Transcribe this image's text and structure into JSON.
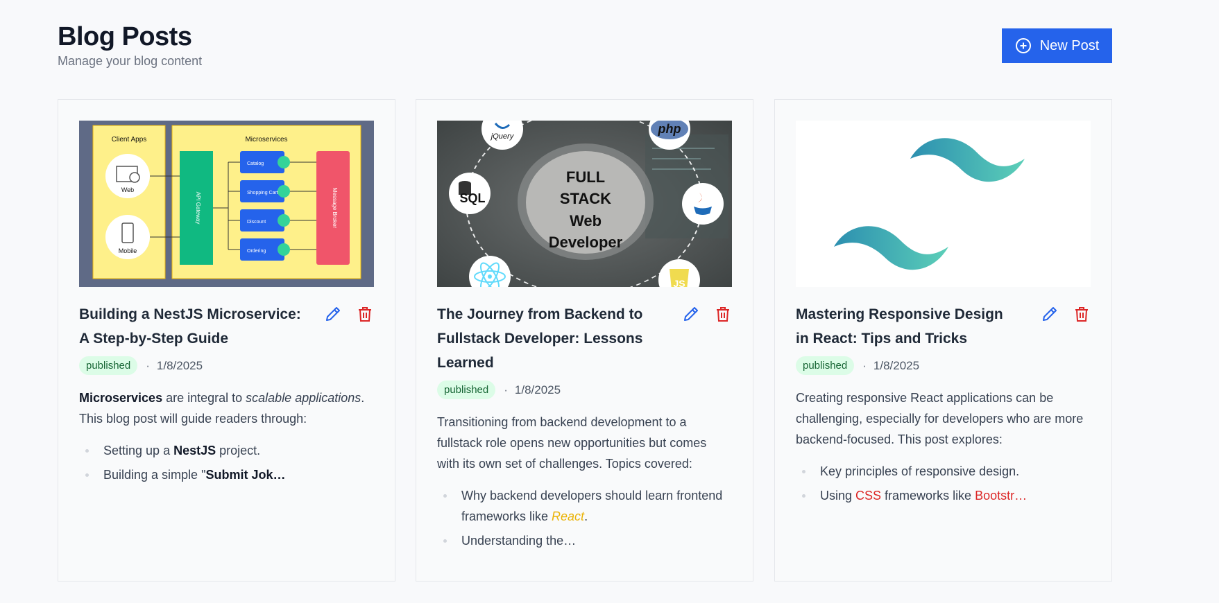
{
  "page": {
    "title": "Blog Posts",
    "subtitle": "Manage your blog content",
    "new_post_label": "New Post"
  },
  "colors": {
    "primary": "#2563eb",
    "delete": "#dc2626",
    "badge_bg": "#dcfce7",
    "badge_text": "#166534"
  },
  "posts": [
    {
      "title": "Building a NestJS Microservice: A Step-by-Step Guide",
      "status": "published",
      "date": "1/8/2025",
      "image": {
        "client_apps": "Client Apps",
        "microservices": "Microservices",
        "web": "Web",
        "mobile": "Mobile",
        "api_gateway": "API Gateway",
        "services": [
          "Catalog",
          "Shopping Cart",
          "Discount",
          "Ordering"
        ],
        "broker": "Message Broker"
      },
      "excerpt": {
        "strong": "Microservices",
        "t1": " are integral to ",
        "em": "scalable applications",
        "t2": ". This blog post will guide readers through:"
      },
      "bullets": [
        {
          "pre": "Setting up a ",
          "strong": "NestJS",
          "post": " project."
        },
        {
          "pre": "Building a simple \"",
          "strong": "Submit Jok…",
          "post": ""
        }
      ]
    },
    {
      "title": "The Journey from Backend to Fullstack Developer: Lessons Learned",
      "status": "published",
      "date": "1/8/2025",
      "image": {
        "l1": "FULL",
        "l2": "STACK",
        "l3": "Web",
        "l4": "Developer",
        "jquery": "jQuery",
        "php": "php",
        "sql": "SQL",
        "js": "JS"
      },
      "excerpt": "Transitioning from backend development to a fullstack role opens new opportunities but comes with its own set of challenges. Topics covered:",
      "bullets": [
        {
          "pre": "Why backend developers should learn frontend frameworks like ",
          "em": "React",
          "post": "."
        },
        {
          "pre": "Understanding the…"
        }
      ]
    },
    {
      "title": "Mastering Responsive Design in React: Tips and Tricks",
      "status": "published",
      "date": "1/8/2025",
      "excerpt": "Creating responsive React applications can be challenging, especially for developers who are more backend-focused. This post explores:",
      "bullets": [
        {
          "pre": "Key principles of responsive design."
        },
        {
          "pre": "Using ",
          "red1": "CSS",
          "mid": " frameworks like ",
          "red2": "Bootstr…"
        }
      ]
    }
  ]
}
